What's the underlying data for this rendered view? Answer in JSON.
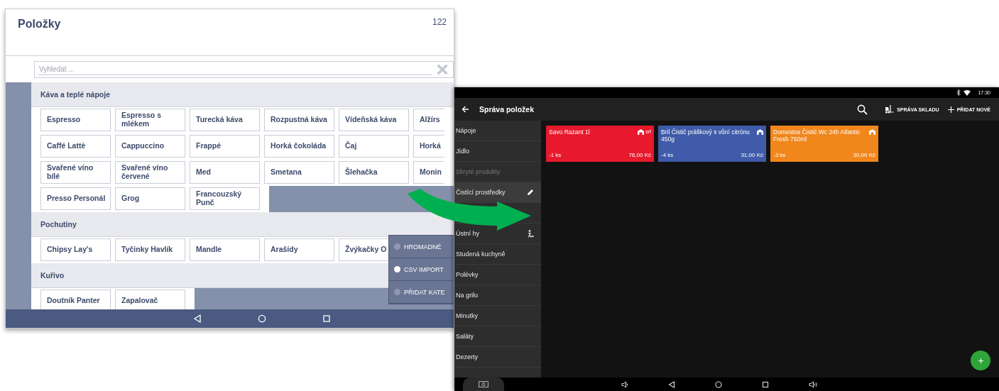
{
  "left_screen": {
    "title": "Položky",
    "count": "122",
    "search": {
      "placeholder": "Vyhledat ..."
    },
    "categories": [
      {
        "name": "Káva a teplé nápoje",
        "rows": [
          [
            "Espresso",
            "Espresso s mlékem",
            "Turecká káva",
            "Rozpustná káva",
            "Vídeňská káva",
            "Alžírs"
          ],
          [
            "Caffé Lattè",
            "Cappuccino",
            "Frappé",
            "Horká čokoláda",
            "Čaj",
            "Horká"
          ],
          [
            "Svařené víno bílé",
            "Svařené víno červené",
            "Med",
            "Smetana",
            "Šlehačka",
            "Monin"
          ],
          [
            "Presso Personál",
            "Grog",
            "Francouzský Punč"
          ]
        ]
      },
      {
        "name": "Pochutiny",
        "rows": [
          [
            "Chipsy Lay's",
            "Tyčinky Havlík",
            "Mandle",
            "Arašídy",
            "Žvýkačky O"
          ]
        ]
      },
      {
        "name": "Kuřivo",
        "rows": [
          [
            "Doutník Panter",
            "Zapalovač"
          ]
        ]
      }
    ],
    "menu": [
      {
        "label": "HROMADNÉ",
        "selected": false
      },
      {
        "label": "CSV IMPORT",
        "selected": true
      },
      {
        "label": "PŘIDAT KATE",
        "selected": false
      }
    ]
  },
  "right_screen": {
    "status_time": "17:30",
    "title": "Správa položek",
    "actions": [
      {
        "kind": "search"
      },
      {
        "kind": "warehouse",
        "label": "SPRÁVA SKLADU"
      },
      {
        "kind": "add",
        "label": "PŘIDAT NOVÉ"
      }
    ],
    "sidebar": [
      {
        "kind": "text",
        "label": "Nápoje",
        "selected": false,
        "disabled": false
      },
      {
        "kind": "text",
        "label": "Jídlo",
        "selected": false,
        "disabled": false
      },
      {
        "kind": "text",
        "label": "Skryté produkty",
        "selected": false,
        "disabled": true
      },
      {
        "kind": "text",
        "label": "Čistící prostředky",
        "selected": true,
        "disabled": false
      },
      {
        "kind": "covered"
      },
      {
        "kind": "figure",
        "label": "Ústní hy",
        "selected": false,
        "disabled": false
      },
      {
        "kind": "text",
        "label": "Studená kuchyně",
        "selected": false,
        "disabled": false
      },
      {
        "kind": "text",
        "label": "Polévky",
        "selected": false,
        "disabled": false
      },
      {
        "kind": "text",
        "label": "Na grilu",
        "selected": false,
        "disabled": false
      },
      {
        "kind": "text",
        "label": "Minutky",
        "selected": false,
        "disabled": false
      },
      {
        "kind": "text",
        "label": "Saláty",
        "selected": false,
        "disabled": false
      },
      {
        "kind": "text",
        "label": "Dezerty",
        "selected": false,
        "disabled": false
      }
    ],
    "products": [
      {
        "name": "Savo Razant 1l",
        "tag": "srf",
        "stock": "-1 ks",
        "price": "78,00 Kč",
        "color": "#e8192c"
      },
      {
        "name": "Bril Čistič práškový s vůní citrónu 450g",
        "stock": "-4 ks",
        "price": "31,00 Kč",
        "color": "#3f5ba9"
      },
      {
        "name": "Domestos Čistič Wc 24h Atlantic Fresh 750ml",
        "stock": "-3 ks",
        "price": "39,00 Kč",
        "color": "#f0861c"
      }
    ]
  }
}
